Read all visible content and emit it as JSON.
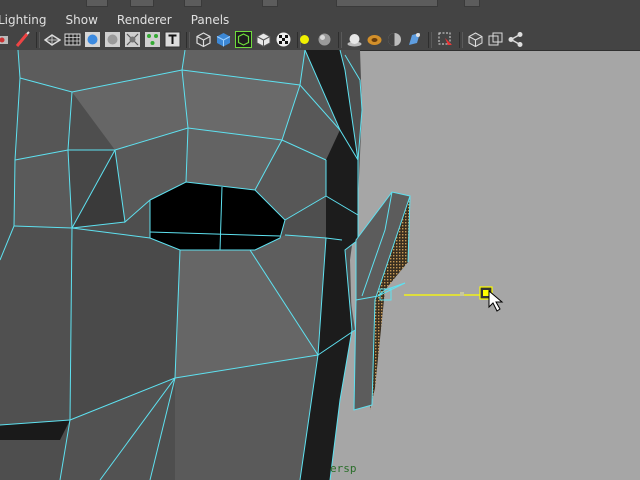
{
  "menubar": {
    "items": [
      {
        "label": "Lighting"
      },
      {
        "label": "Show"
      },
      {
        "label": "Renderer"
      },
      {
        "label": "Panels"
      }
    ]
  },
  "toolbar": {
    "buttons": [
      {
        "icon": "camera-icon"
      },
      {
        "icon": "paint-brush-icon"
      },
      {
        "icon": "wireframe-icon"
      },
      {
        "icon": "grid-icon"
      },
      {
        "icon": "smooth-shade-icon"
      },
      {
        "icon": "flat-shade-icon"
      },
      {
        "icon": "wireframe-on-shaded-icon"
      },
      {
        "icon": "xray-icon"
      },
      {
        "icon": "texture-icon"
      },
      {
        "icon": "cube-outline-icon"
      },
      {
        "icon": "cube-solid-icon"
      },
      {
        "icon": "isolate-select-icon"
      },
      {
        "icon": "cube-textured-icon"
      },
      {
        "icon": "checker-icon"
      },
      {
        "icon": "default-light-icon"
      },
      {
        "icon": "sphere-shade-icon"
      },
      {
        "icon": "use-all-lights-icon"
      },
      {
        "icon": "shadows-icon"
      },
      {
        "icon": "ambient-occlusion-icon"
      },
      {
        "icon": "render-settings-icon"
      },
      {
        "icon": "selection-highlight-icon"
      },
      {
        "icon": "wireframe-box-icon"
      },
      {
        "icon": "xray-box-icon"
      },
      {
        "icon": "component-share-icon"
      }
    ]
  },
  "viewport": {
    "camera_label": "ersp",
    "wire_color": "#5ee1f0",
    "manipulator_color": "#ffff00"
  }
}
